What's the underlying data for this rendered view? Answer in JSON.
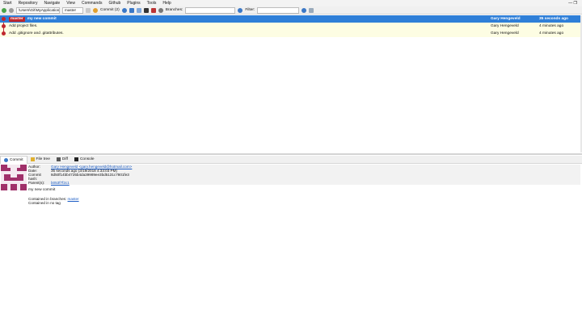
{
  "menu": [
    "Start",
    "Repository",
    "Navigate",
    "View",
    "Commands",
    "Github",
    "Plugins",
    "Tools",
    "Help"
  ],
  "window": {
    "minimize": "—",
    "restore": "❐"
  },
  "toolbar": {
    "repo_path": "\\Users\\Git\\MyApplication\\",
    "branch": "master",
    "commit_label": "Commit (2)",
    "branches_label": "Branches:",
    "branches_value": "",
    "filter_label": "Filter:",
    "filter_value": ""
  },
  "commits": [
    {
      "branch_tag": "master",
      "message": "my new commit",
      "author": "Gary Hengeveld",
      "date": "35 seconds ago",
      "selected": true
    },
    {
      "branch_tag": "",
      "message": "Add project files.",
      "author": "Gary Hengeveld",
      "date": "4 minutes ago",
      "selected": false
    },
    {
      "branch_tag": "",
      "message": "Add .gitignore and .gitattributes.",
      "author": "Gary Hengeveld",
      "date": "4 minutes ago",
      "selected": false
    }
  ],
  "tabs": [
    {
      "label": "Commit",
      "icon": "commit-icon"
    },
    {
      "label": "File tree",
      "icon": "file-tree-icon"
    },
    {
      "label": "Diff",
      "icon": "diff-icon"
    },
    {
      "label": "Console",
      "icon": "console-icon"
    }
  ],
  "detail": {
    "author_key": "Author:",
    "author_val": "Gary Hengeveld <gary.hengeveld@hotmail.com>",
    "date_key": "Date:",
    "date_val": "35 seconds ago (3/19/2018 4:33:03 PM)",
    "hash_key": "Commit hash:",
    "hash_val": "8d50f14bb4725b4da39989ee3bd5131c7801fe3",
    "parent_key": "Parent(s):",
    "parent_val": "b053f7f2c1",
    "message": "my new commit",
    "branches_text": "Contained in branches:",
    "branches_link": "master",
    "tags_text": "Contained in no tag"
  },
  "colors": {
    "selected": "#2f7fd8",
    "graph": "#c0272d",
    "alt_row": "#fdfde3"
  }
}
